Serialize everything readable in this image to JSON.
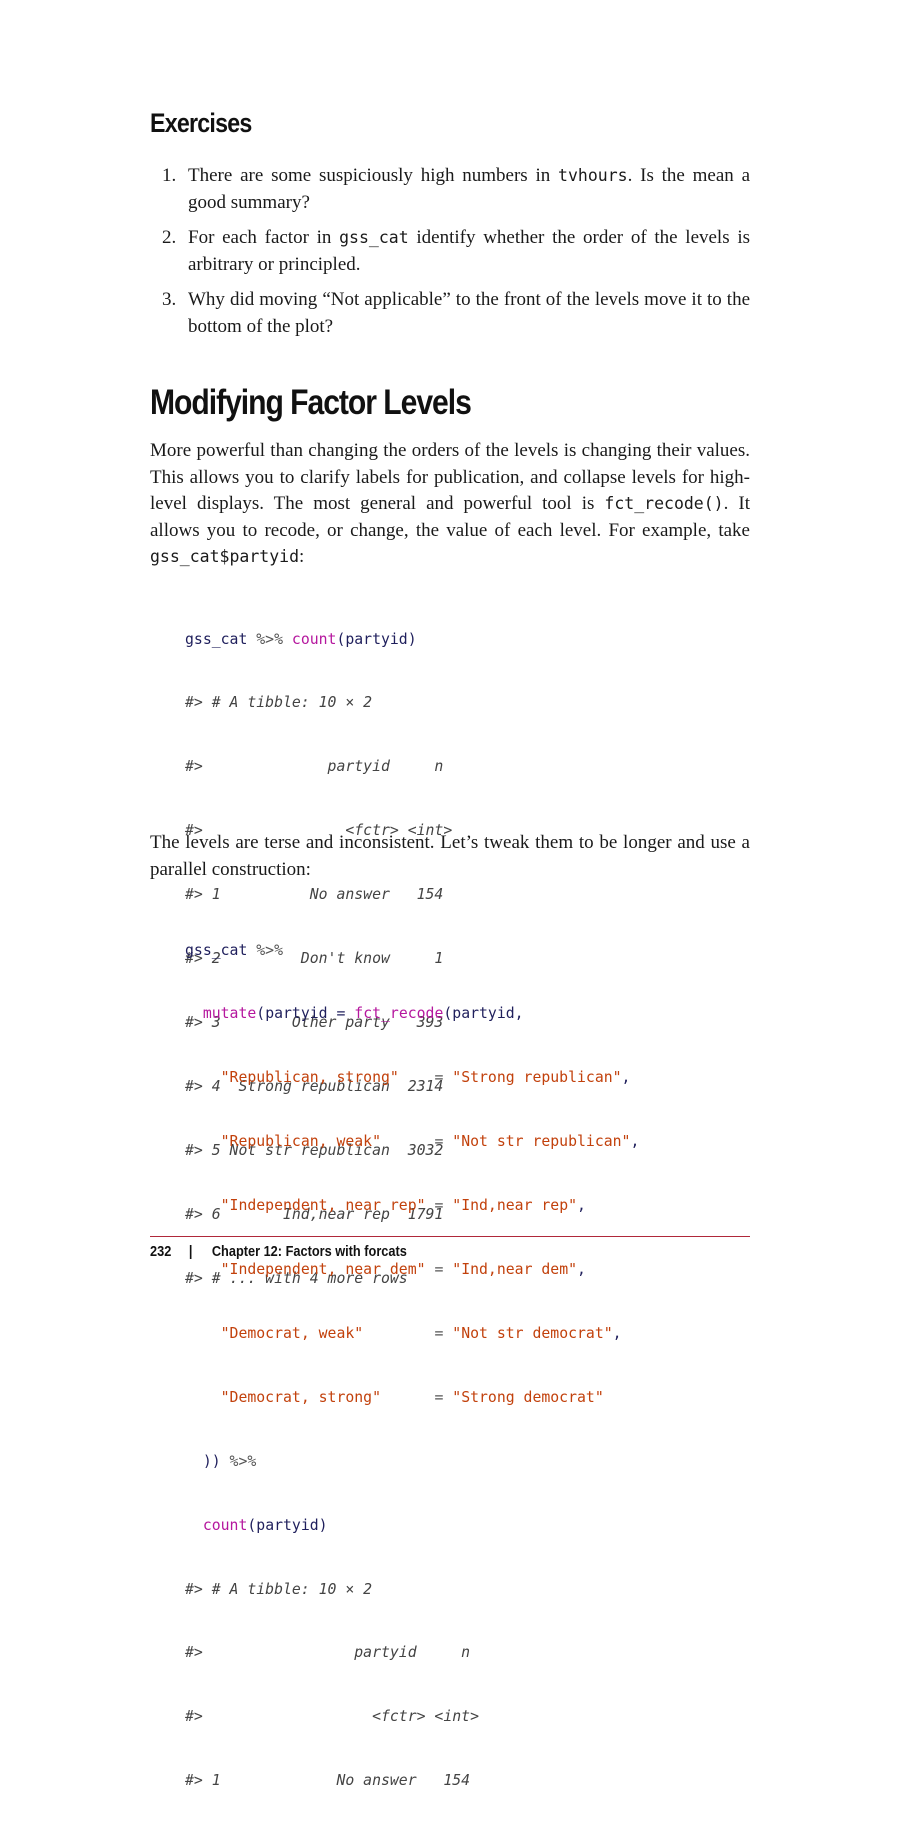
{
  "exercises_heading": "Exercises",
  "exercises": [
    {
      "num": "1.",
      "before": "There are some suspiciously high numbers in ",
      "code": "tvhours",
      "after": ". Is the mean a good summary?"
    },
    {
      "num": "2.",
      "before": "For each factor in ",
      "code": "gss_cat",
      "after": " identify whether the order of the lev­els is arbitrary or principled."
    },
    {
      "num": "3.",
      "before": "Why did moving “Not applicable” to the front of the levels move it to the bottom of the plot?",
      "code": "",
      "after": ""
    }
  ],
  "section_heading": "Modifying Factor Levels",
  "para1": {
    "a": "More powerful than changing the orders of the levels is changing their values. This allows you to clarify labels for publication, and collapse levels for high-level displays. The most general and power­ful tool is ",
    "code1": "fct_recode()",
    "b": ". It allows you to recode, or change, the value of each level. For example, take ",
    "code2": "gss_cat$partyid",
    "c": ":"
  },
  "code1": {
    "line1_obj": "gss_cat",
    "line1_pipe": " %>% ",
    "line1_fn": "count",
    "line1_arg": "(partyid)",
    "output": [
      "#> # A tibble: 10 × 2",
      "#>              partyid     n",
      "#>                <fctr> <int>",
      "#> 1          No answer   154",
      "#> 2         Don't know     1",
      "#> 3        Other party   393",
      "#> 4  Strong republican  2314",
      "#> 5 Not str republican  3032",
      "#> 6       Ind,near rep  1791",
      "#> # ... with 4 more rows"
    ]
  },
  "para2": "The levels are terse and inconsistent. Let’s tweak them to be longer and use a parallel construction:",
  "code2": {
    "l1_obj": "gss_cat",
    "l1_pipe": " %>%",
    "l2_indent": "  ",
    "l2_fn": "mutate",
    "l2_a": "(partyid = ",
    "l2_fn2": "fct_recode",
    "l2_b": "(partyid,",
    "recodes": [
      {
        "from": "\"Republican, strong\"",
        "pad": "    ",
        "to": "\"Strong republican\"",
        "end": ","
      },
      {
        "from": "\"Republican, weak\"",
        "pad": "      ",
        "to": "\"Not str republican\"",
        "end": ","
      },
      {
        "from": "\"Independent, near rep\"",
        "pad": " ",
        "to": "\"Ind,near rep\"",
        "end": ","
      },
      {
        "from": "\"Independent, near dem\"",
        "pad": " ",
        "to": "\"Ind,near dem\"",
        "end": ","
      },
      {
        "from": "\"Democrat, weak\"",
        "pad": "        ",
        "to": "\"Not str democrat\"",
        "end": ","
      },
      {
        "from": "\"Democrat, strong\"",
        "pad": "      ",
        "to": "\"Strong democrat\"",
        "end": ""
      }
    ],
    "close_a": "  ))",
    "close_pipe": " %>%",
    "count_indent": "  ",
    "count_fn": "count",
    "count_arg": "(partyid)",
    "output": [
      "#> # A tibble: 10 × 2",
      "#>                 partyid     n",
      "#>                   <fctr> <int>",
      "#> 1             No answer   154"
    ]
  },
  "footer": {
    "page_number": "232",
    "separator": "|",
    "chapter": "Chapter 12: Factors with forcats"
  }
}
